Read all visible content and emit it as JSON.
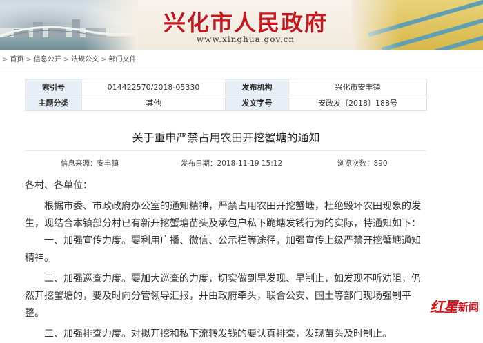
{
  "header": {
    "site_title": "兴化市人民政府",
    "site_domain": "www.xinghua.gov.cn"
  },
  "breadcrumb": {
    "items": [
      "首页",
      "信息公开",
      "法规公文",
      "部门文件"
    ],
    "separator": ">"
  },
  "info_table": {
    "rows": [
      [
        {
          "label": "索引号",
          "value": "014422570/2018-05330"
        },
        {
          "label": "发布机构",
          "value": "兴化市安丰镇"
        }
      ],
      [
        {
          "label": "主题分类",
          "value": "其他"
        },
        {
          "label": "发文字号",
          "value": "安政发〔2018〕188号"
        }
      ]
    ]
  },
  "article": {
    "title": "关于重申严禁占用农田开挖蟹塘的通知",
    "source_label": "信息来源：",
    "source_value": "安丰镇",
    "date_label": "发布日期：",
    "date_value": "2018-11-19 15:12",
    "views_label": "浏览次数：",
    "views_value": "890",
    "salutation": "各村、各单位：",
    "intro": "根据市委、市政政府办公室的通知精神，严禁占用农田开挖蟹塘，杜绝毁坏农田现象的发生，现结合本镇部分村已有新开挖蟹塘苗头及承包户私下跪塘发钱行为的实际，特通知如下：",
    "sections": [
      {
        "heading": "一、加强宣传力度。",
        "text": "要利用广播、微信、公示栏等途径，加强宣传上级严禁开挖蟹塘通知精神。"
      },
      {
        "heading": "二、加强巡查力度。",
        "text": "要加大巡查的力度，切实做到早发现、早制止，如发现不听劝阻，仍然开挖蟹塘的，要及时向分管领导汇报，并由政府牵头，联合公安、国土等部门现场强制平整。"
      },
      {
        "heading": "三、加强排查力度。",
        "text": "对拟开挖和私下流转发钱的要认真排查，发现苗头及时制止。"
      }
    ]
  },
  "watermark": {
    "logo_text": "红星",
    "text": "新闻"
  },
  "colors": {
    "brand_red": "#c8161d",
    "table_key_bg": "#e8eef5",
    "watermark_red": "#d8141b"
  }
}
